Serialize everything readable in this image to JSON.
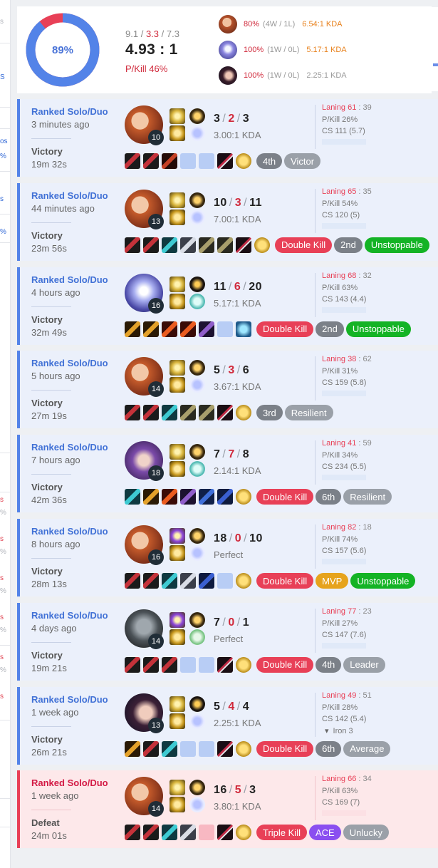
{
  "summary": {
    "winrate": "89%",
    "winrate_value": 0.89,
    "avg_kills": "9.1",
    "avg_deaths": "3.3",
    "avg_assists": "7.3",
    "slash": "/",
    "kda_ratio": "4.93 : 1",
    "pkill": "P/Kill 46%",
    "champions": [
      {
        "icon": "champion-fire-girl-icon",
        "winrate": "80%",
        "record": "(4W / 1L)",
        "kda": "6.54:1 KDA",
        "kda_color": "#e8821e"
      },
      {
        "icon": "champion-silver-mage-icon",
        "winrate": "100%",
        "record": "(1W / 0L)",
        "kda": "5.17:1 KDA",
        "kda_color": "#e8821e"
      },
      {
        "icon": "champion-dark-hair-icon",
        "winrate": "100%",
        "record": "(1W / 0L)",
        "kda": "2.25:1 KDA",
        "kda_color": "#999999"
      }
    ]
  },
  "games": [
    {
      "queue": "Ranked Solo/Duo",
      "time": "3 minutes ago",
      "result": "Victory",
      "length": "19m 32s",
      "level": "10",
      "kills": "3",
      "deaths": "2",
      "assists": "3",
      "ratio": "3.00:1 KDA",
      "laning_label": "Laning 61",
      "laning_opp": " : 39",
      "pkill": "P/Kill 26%",
      "cs": "CS 111 (5.7)",
      "rank": "",
      "badges": [
        {
          "text": "4th",
          "kind": "pos"
        },
        {
          "text": "Victor",
          "kind": "tag"
        }
      ]
    },
    {
      "queue": "Ranked Solo/Duo",
      "time": "44 minutes ago",
      "result": "Victory",
      "length": "23m 56s",
      "level": "13",
      "kills": "10",
      "deaths": "3",
      "assists": "11",
      "ratio": "7.00:1 KDA",
      "laning_label": "Laning 65",
      "laning_opp": " : 35",
      "pkill": "P/Kill 54%",
      "cs": "CS 120 (5)",
      "rank": "",
      "badges": [
        {
          "text": "Double Kill",
          "kind": "kill"
        },
        {
          "text": "2nd",
          "kind": "pos"
        },
        {
          "text": "Unstoppable",
          "kind": "green"
        }
      ]
    },
    {
      "queue": "Ranked Solo/Duo",
      "time": "4 hours ago",
      "result": "Victory",
      "length": "32m 49s",
      "level": "16",
      "kills": "11",
      "deaths": "6",
      "assists": "20",
      "ratio": "5.17:1 KDA",
      "laning_label": "Laning 68",
      "laning_opp": " : 32",
      "pkill": "P/Kill 63%",
      "cs": "CS 143 (4.4)",
      "rank": "",
      "badges": [
        {
          "text": "Double Kill",
          "kind": "kill"
        },
        {
          "text": "2nd",
          "kind": "pos"
        },
        {
          "text": "Unstoppable",
          "kind": "green"
        }
      ]
    },
    {
      "queue": "Ranked Solo/Duo",
      "time": "5 hours ago",
      "result": "Victory",
      "length": "27m 19s",
      "level": "14",
      "kills": "5",
      "deaths": "3",
      "assists": "6",
      "ratio": "3.67:1 KDA",
      "laning_label": "Laning 38",
      "laning_opp": " : 62",
      "pkill": "P/Kill 31%",
      "cs": "CS 159 (5.8)",
      "rank": "",
      "badges": [
        {
          "text": "3rd",
          "kind": "pos"
        },
        {
          "text": "Resilient",
          "kind": "tag"
        }
      ]
    },
    {
      "queue": "Ranked Solo/Duo",
      "time": "7 hours ago",
      "result": "Victory",
      "length": "42m 36s",
      "level": "18",
      "kills": "7",
      "deaths": "7",
      "assists": "8",
      "ratio": "2.14:1 KDA",
      "laning_label": "Laning 41",
      "laning_opp": " : 59",
      "pkill": "P/Kill 34%",
      "cs": "CS 234 (5.5)",
      "rank": "",
      "badges": [
        {
          "text": "Double Kill",
          "kind": "kill"
        },
        {
          "text": "6th",
          "kind": "pos"
        },
        {
          "text": "Resilient",
          "kind": "tag"
        }
      ]
    },
    {
      "queue": "Ranked Solo/Duo",
      "time": "8 hours ago",
      "result": "Victory",
      "length": "28m 13s",
      "level": "16",
      "kills": "18",
      "deaths": "0",
      "assists": "10",
      "ratio": "Perfect",
      "laning_label": "Laning 82",
      "laning_opp": " : 18",
      "pkill": "P/Kill 74%",
      "cs": "CS 157 (5.6)",
      "rank": "",
      "badges": [
        {
          "text": "Double Kill",
          "kind": "kill"
        },
        {
          "text": "MVP",
          "kind": "mvp"
        },
        {
          "text": "Unstoppable",
          "kind": "green"
        }
      ]
    },
    {
      "queue": "Ranked Solo/Duo",
      "time": "4 days ago",
      "result": "Victory",
      "length": "19m 21s",
      "level": "14",
      "kills": "7",
      "deaths": "0",
      "assists": "1",
      "ratio": "Perfect",
      "laning_label": "Laning 77",
      "laning_opp": " : 23",
      "pkill": "P/Kill 27%",
      "cs": "CS 147 (7.6)",
      "rank": "",
      "badges": [
        {
          "text": "Double Kill",
          "kind": "kill"
        },
        {
          "text": "4th",
          "kind": "pos"
        },
        {
          "text": "Leader",
          "kind": "tag"
        }
      ]
    },
    {
      "queue": "Ranked Solo/Duo",
      "time": "1 week ago",
      "result": "Victory",
      "length": "26m 21s",
      "level": "13",
      "kills": "5",
      "deaths": "4",
      "assists": "4",
      "ratio": "2.25:1 KDA",
      "laning_label": "Laning 49",
      "laning_opp": " : 51",
      "pkill": "P/Kill 28%",
      "cs": "CS 142 (5.4)",
      "rank": "Iron 3",
      "badges": [
        {
          "text": "Double Kill",
          "kind": "kill"
        },
        {
          "text": "6th",
          "kind": "pos"
        },
        {
          "text": "Average",
          "kind": "tag"
        }
      ]
    },
    {
      "queue": "Ranked Solo/Duo",
      "time": "1 week ago",
      "result": "Defeat",
      "length": "24m 01s",
      "level": "14",
      "kills": "16",
      "deaths": "5",
      "assists": "3",
      "ratio": "3.80:1 KDA",
      "laning_label": "Laning 66",
      "laning_opp": " : 34",
      "pkill": "P/Kill 63%",
      "cs": "CS 169 (7)",
      "rank": "",
      "badges": [
        {
          "text": "Triple Kill",
          "kind": "kill"
        },
        {
          "text": "ACE",
          "kind": "ace"
        },
        {
          "text": "Unlucky",
          "kind": "tag"
        }
      ]
    }
  ],
  "left_marks": [
    "s",
    "S",
    "os",
    "%",
    "s",
    "%",
    "s",
    "%",
    "s",
    "%",
    "s",
    "%",
    "s",
    "%",
    "s",
    "%",
    "s"
  ],
  "colors": {
    "win": "#5383e8",
    "loss": "#e84057",
    "win_bg": "#ebf0fb",
    "loss_bg": "#fde8ea",
    "death": "#d0293b"
  }
}
